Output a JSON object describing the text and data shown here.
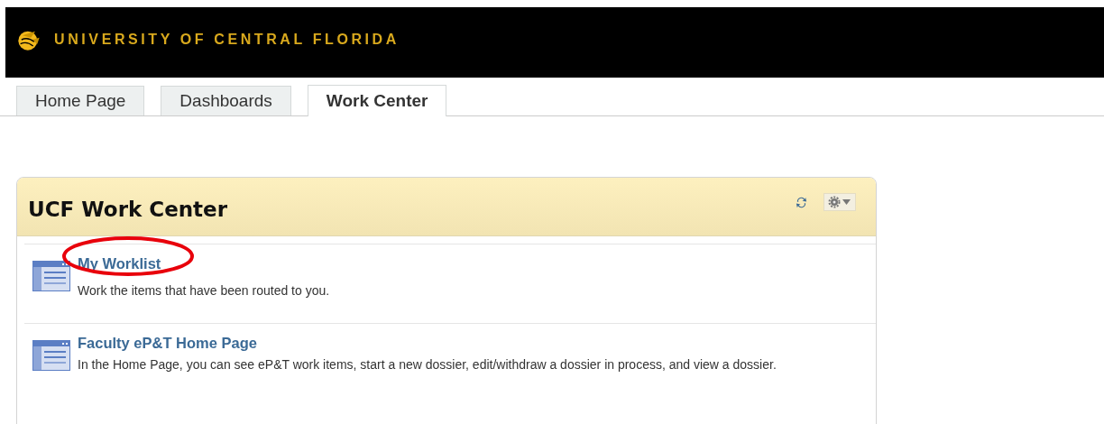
{
  "header": {
    "title": "UNIVERSITY OF CENTRAL FLORIDA"
  },
  "tabs": [
    {
      "label": "Home Page",
      "selected": false
    },
    {
      "label": "Dashboards",
      "selected": false
    },
    {
      "label": "Work Center",
      "selected": true
    }
  ],
  "work_center": {
    "title": "UCF Work Center",
    "items": [
      {
        "title": "My Worklist",
        "description": "Work the items that have been routed to you.",
        "circled": true
      },
      {
        "title": "Faculty eP&T Home Page",
        "description": "In the Home Page, you can see eP&T work items, start a new dossier, edit/withdraw a dossier in process, and view a dossier.",
        "circled": false
      }
    ]
  }
}
